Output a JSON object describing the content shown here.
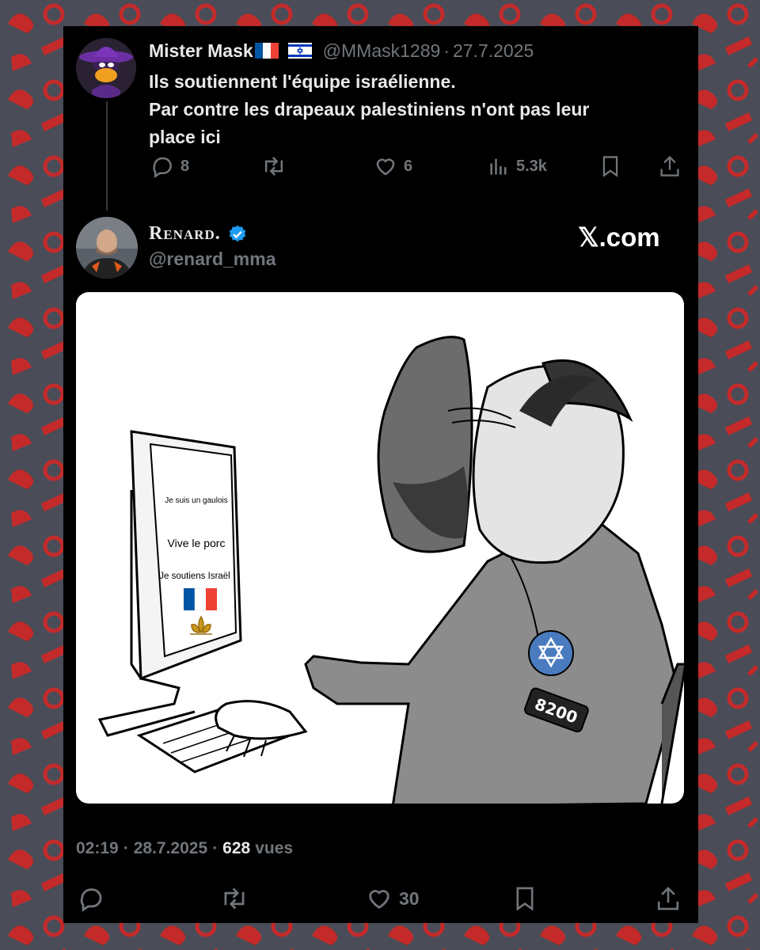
{
  "quoted_tweet": {
    "author_name": "Mister Mask",
    "name_flags": [
      "flag-france-icon",
      "flag-israel-icon"
    ],
    "handle": "@MMask1289",
    "separator": "·",
    "date": "27.7.2025",
    "text_lines": [
      "Ils soutiennent l'équipe israélienne.",
      "Par contre les drapeaux palestiniens n'ont pas leur",
      "place ici"
    ],
    "actions": {
      "replies": "8",
      "retweets": "",
      "likes": "6",
      "views": "5.3k"
    }
  },
  "main_tweet": {
    "author_name": "Renard.",
    "verified": true,
    "handle": "@renard_mma",
    "brand": "𝕏.com",
    "timestamp_time": "02:19",
    "timestamp_date": "28.7.2025",
    "separator": "·",
    "views_count": "628",
    "views_label": "vues",
    "actions": {
      "likes": "30"
    }
  },
  "media": {
    "monitor_lines": [
      "Je suis un gaulois",
      "Vive le porc",
      "Je soutiens Israël"
    ],
    "badge_text": "8200"
  },
  "colors": {
    "card_bg": "#000000",
    "text_primary": "#e7e9ea",
    "text_muted": "#71767b",
    "verified_blue": "#1d9bf0",
    "background_pattern": "#c42a2a",
    "background_base": "#4a4c57"
  }
}
